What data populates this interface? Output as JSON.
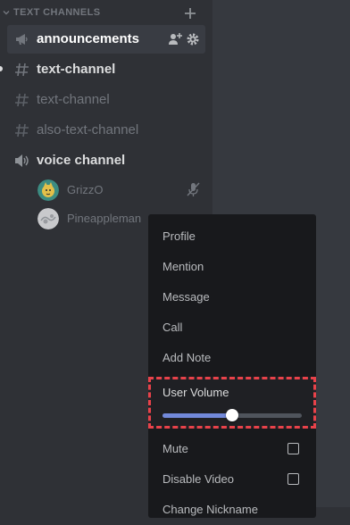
{
  "sidebar": {
    "category": {
      "label": "TEXT CHANNELS",
      "icon": "chevron-down-icon",
      "add_icon": "plus-icon"
    },
    "channels": [
      {
        "label": "announcements",
        "icon": "megaphone-icon",
        "selected": true,
        "actions": [
          "add-member-icon",
          "gear-icon"
        ]
      },
      {
        "label": "text-channel",
        "icon": "hash-icon",
        "unread": true
      },
      {
        "label": "text-channel",
        "icon": "hash-icon"
      },
      {
        "label": "also-text-channel",
        "icon": "hash-icon"
      },
      {
        "label": "voice channel",
        "icon": "speaker-icon"
      }
    ],
    "voice_users": [
      {
        "name": "GrizzO",
        "avatar": "green-avatar",
        "status_icon": "muted-mic-icon"
      },
      {
        "name": "Pineappleman",
        "avatar": "grey-avatar"
      }
    ]
  },
  "context_menu": {
    "items": [
      {
        "label": "Profile"
      },
      {
        "label": "Mention"
      },
      {
        "label": "Message"
      },
      {
        "label": "Call"
      },
      {
        "label": "Add Note"
      }
    ],
    "user_volume": {
      "label": "User Volume",
      "level_fraction": 0.5
    },
    "toggles": [
      {
        "label": "Mute",
        "checked": false
      },
      {
        "label": "Disable Video",
        "checked": false
      },
      {
        "label": "Change Nickname"
      }
    ]
  },
  "colors": {
    "accent": "#7289da",
    "highlight_border": "#e8424a",
    "menu_bg": "#18191c",
    "sidebar_bg": "#2f3136"
  }
}
